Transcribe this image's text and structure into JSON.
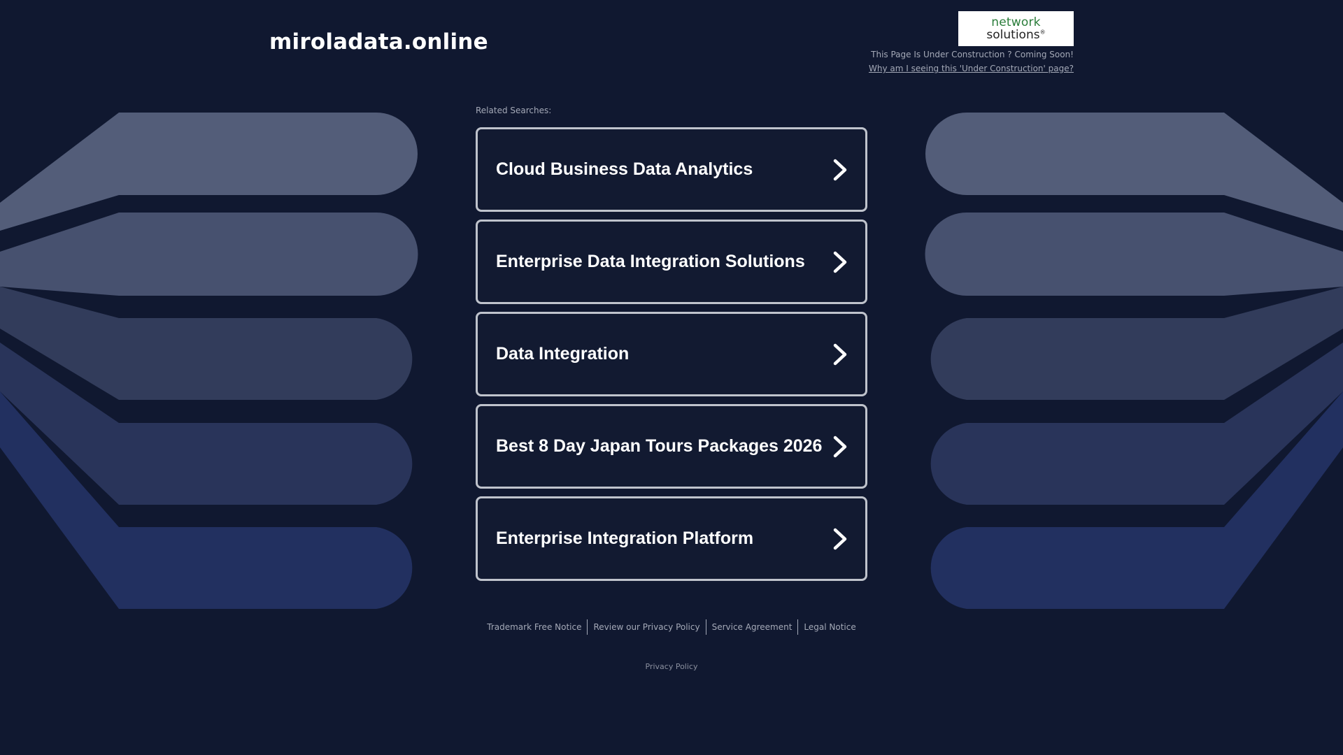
{
  "header": {
    "domain": "miroladata.online",
    "logo": {
      "line1": "network",
      "line2": "solutions",
      "reg": "®"
    },
    "under_construction": "This Page Is Under Construction ? Coming Soon!",
    "why_link": "Why am I seeing this 'Under Construction' page?"
  },
  "main": {
    "related_label": "Related Searches:",
    "results": [
      {
        "title": "Cloud Business Data Analytics"
      },
      {
        "title": "Enterprise Data Integration Solutions"
      },
      {
        "title": "Data Integration"
      },
      {
        "title": "Best 8 Day Japan Tours Packages 2026"
      },
      {
        "title": "Enterprise Integration Platform"
      }
    ]
  },
  "footer": {
    "links": [
      "Trademark Free Notice",
      "Review our Privacy Policy",
      "Service Agreement",
      "Legal Notice"
    ],
    "privacy_policy": "Privacy Policy"
  },
  "icons": {
    "result_arrow": "chevron-right-icon"
  },
  "colors": {
    "background": "#101830",
    "logo_green": "#2a7d3a",
    "muted_text": "#a4a9b7",
    "result_border": "#bfc3cc"
  }
}
